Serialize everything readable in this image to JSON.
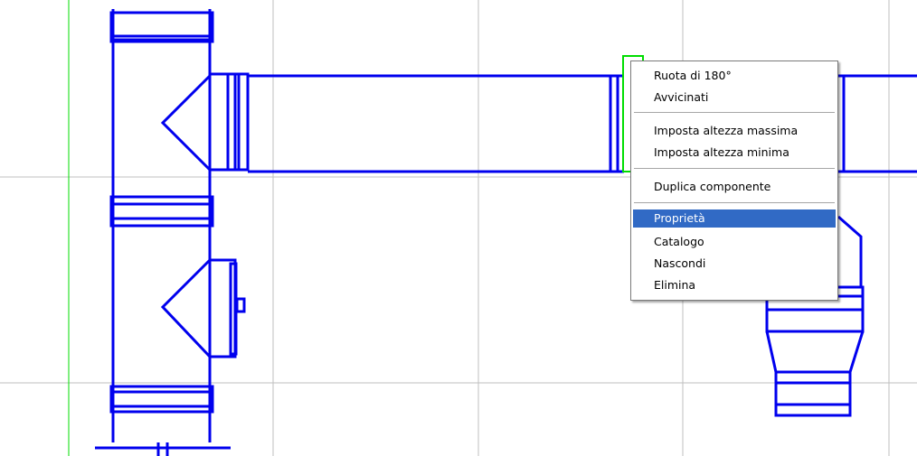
{
  "colors": {
    "pipe": "#0000ee",
    "grid": "#bfbfbf",
    "axis": "#00dd00",
    "selection": "#316ac5"
  },
  "context_menu": {
    "items": [
      {
        "label": "Ruota di 180°",
        "selected": false
      },
      {
        "label": "Avvicinati",
        "selected": false
      },
      {
        "separator": true
      },
      {
        "label": "Imposta altezza massima",
        "selected": false
      },
      {
        "label": "Imposta altezza minima",
        "selected": false
      },
      {
        "separator": true
      },
      {
        "label": "Duplica componente",
        "selected": false
      },
      {
        "separator": true
      },
      {
        "label": "Proprietà",
        "selected": true
      },
      {
        "label": "Catalogo",
        "selected": false
      },
      {
        "label": "Nascondi",
        "selected": false
      },
      {
        "label": "Elimina",
        "selected": false
      }
    ]
  }
}
